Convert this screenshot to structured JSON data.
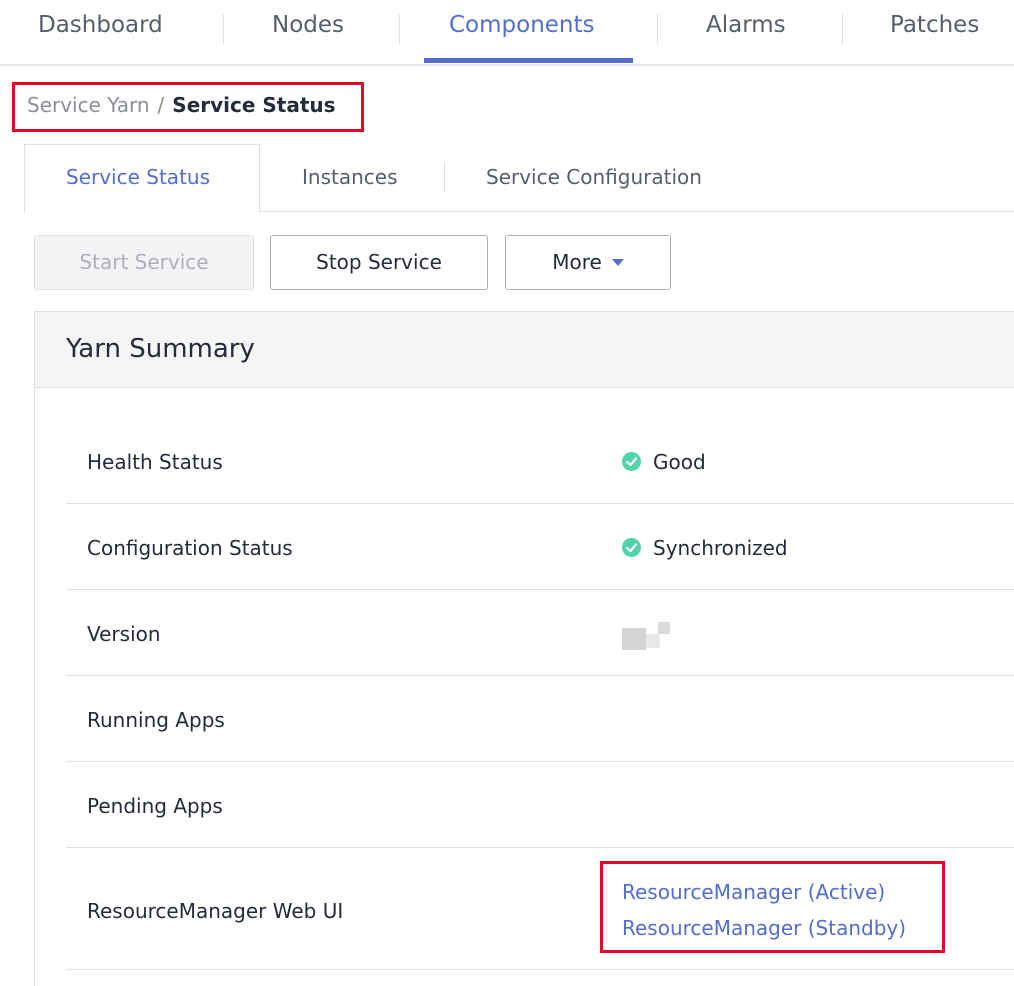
{
  "topnav": {
    "tabs": [
      {
        "label": "Dashboard"
      },
      {
        "label": "Nodes"
      },
      {
        "label": "Components"
      },
      {
        "label": "Alarms"
      },
      {
        "label": "Patches"
      }
    ],
    "active_tab": "Components"
  },
  "breadcrumb": {
    "parent": "Service Yarn",
    "separator": "/",
    "current": "Service Status"
  },
  "subtabs": [
    {
      "label": "Service Status"
    },
    {
      "label": "Instances"
    },
    {
      "label": "Service Configuration"
    }
  ],
  "actions": {
    "start_label": "Start Service",
    "stop_label": "Stop Service",
    "more_label": "More"
  },
  "summary": {
    "title": "Yarn Summary",
    "rows": [
      {
        "label": "Health Status",
        "value": "Good",
        "icon": "check-circle-icon"
      },
      {
        "label": "Configuration Status",
        "value": "Synchronized",
        "icon": "check-circle-icon"
      },
      {
        "label": "Version",
        "value": ""
      },
      {
        "label": "Running Apps",
        "value": ""
      },
      {
        "label": "Pending Apps",
        "value": ""
      },
      {
        "label": "ResourceManager Web UI",
        "links": [
          "ResourceManager (Active)",
          "ResourceManager (Standby)"
        ]
      }
    ]
  },
  "colors": {
    "accent": "#526ecc",
    "success": "#50d4ab",
    "highlight": "#e60a28"
  }
}
